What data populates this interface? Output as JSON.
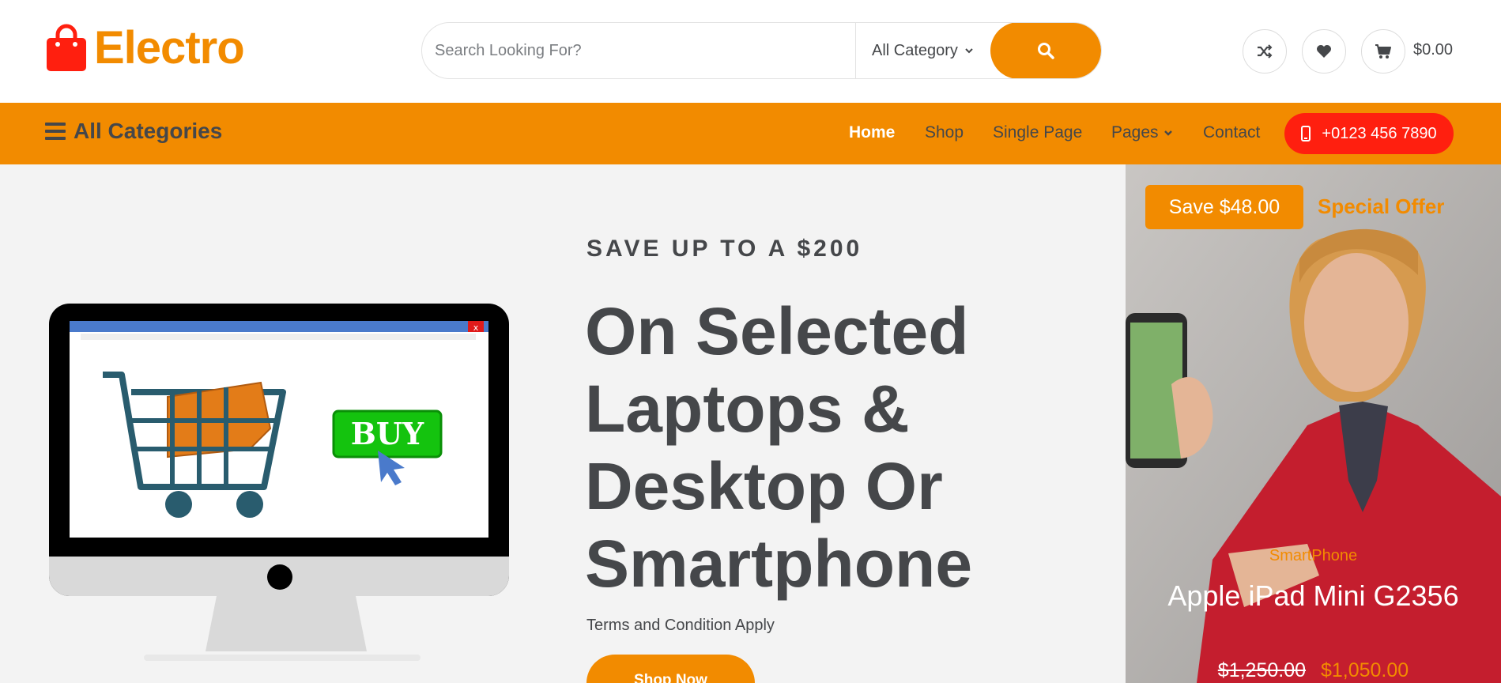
{
  "brand": {
    "name": "Electro",
    "color": "#f28b00"
  },
  "search": {
    "placeholder": "Search Looking For?",
    "category": "All Category",
    "button_icon": "search-icon"
  },
  "header_icons": [
    "shuffle-icon",
    "heart-icon",
    "cart-icon"
  ],
  "cart": {
    "total": "$0.00"
  },
  "nav": {
    "all_categories": "All Categories",
    "links": [
      "Home",
      "Shop",
      "Single Page",
      "Pages",
      "Contact"
    ],
    "active": "Home",
    "phone": "+0123 456 7890"
  },
  "hero": {
    "eyebrow": "SAVE UP TO A $200",
    "title": "On Selected Laptops & Desktop Or Smartphone",
    "terms": "Terms and Condition Apply",
    "cta": "Shop Now",
    "illustration_text": "BUY"
  },
  "offer": {
    "save": "Save $48.00",
    "label": "Special Offer",
    "category": "SmartPhone",
    "name": "Apple iPad Mini G2356",
    "old_price": "$1,250.00",
    "new_price": "$1,050.00"
  },
  "colors": {
    "accent": "#f28b00",
    "phone_button": "#ff1f0f",
    "text": "#45474a",
    "hero_bg": "#f3f3f3"
  }
}
